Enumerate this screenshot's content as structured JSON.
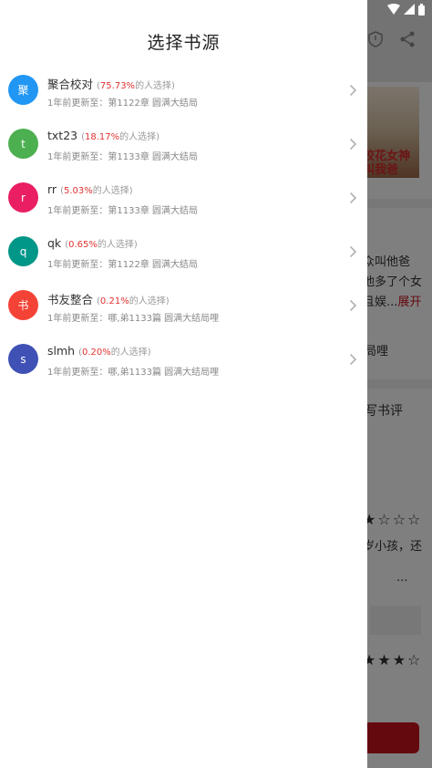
{
  "drawer": {
    "title": "选择书源",
    "sources": [
      {
        "avatar": "聚",
        "avatar_color": "#2196f3",
        "name": "聚合校对",
        "pct_open": "(",
        "pct": "75.73%",
        "pct_suffix": "的人选择)",
        "update_prefix": "1年前更新至：",
        "update": "第1122章 圆满大结局"
      },
      {
        "avatar": "t",
        "avatar_color": "#4caf50",
        "name": "txt23",
        "pct_open": "(",
        "pct": "18.17%",
        "pct_suffix": "的人选择)",
        "update_prefix": "1年前更新至：",
        "update": "第1133章 圆满大结局"
      },
      {
        "avatar": "r",
        "avatar_color": "#e91e63",
        "name": "rr",
        "pct_open": "(",
        "pct": "5.03%",
        "pct_suffix": "的人选择)",
        "update_prefix": "1年前更新至：",
        "update": "第1133章 圆满大结局"
      },
      {
        "avatar": "q",
        "avatar_color": "#009688",
        "name": "qk",
        "pct_open": "(",
        "pct": "0.65%",
        "pct_suffix": "的人选择)",
        "update_prefix": "1年前更新至：",
        "update": "第1122章 圆满大结局"
      },
      {
        "avatar": "书",
        "avatar_color": "#f44336",
        "name": "书友整合",
        "pct_open": "(",
        "pct": "0.21%",
        "pct_suffix": "的人选择)",
        "update_prefix": "1年前更新至：",
        "update": "哪,弟1133篇 圆满大结局哩"
      },
      {
        "avatar": "s",
        "avatar_color": "#3f51b5",
        "name": "slmh",
        "pct_open": "(",
        "pct": "0.20%",
        "pct_suffix": "的人选择)",
        "update_prefix": "1年前更新至：",
        "update": "哪,弟1133篇 圆满大结局哩"
      }
    ]
  },
  "background": {
    "cover_line1": "校花女神",
    "cover_line2": "叫我爸",
    "desc_line1": "众叫他爸",
    "desc_line2": "他多了个女",
    "desc_line3": "且娱...",
    "expand": "展开",
    "latest_chapter": "局哩",
    "write_review": "写书评",
    "review_text": "岁小孩，还",
    "stars_row1": "★☆☆☆",
    "stars_row2": "★★★☆",
    "dots": "···"
  },
  "colors": {
    "accent_red": "#c8141e",
    "percent_red": "#e03232"
  },
  "icons": {
    "shield": "shield-icon",
    "share": "share-icon",
    "chevron": "chevron-right-icon",
    "wifi": "wifi-icon",
    "cellular": "cellular-signal-icon",
    "battery": "battery-icon"
  }
}
